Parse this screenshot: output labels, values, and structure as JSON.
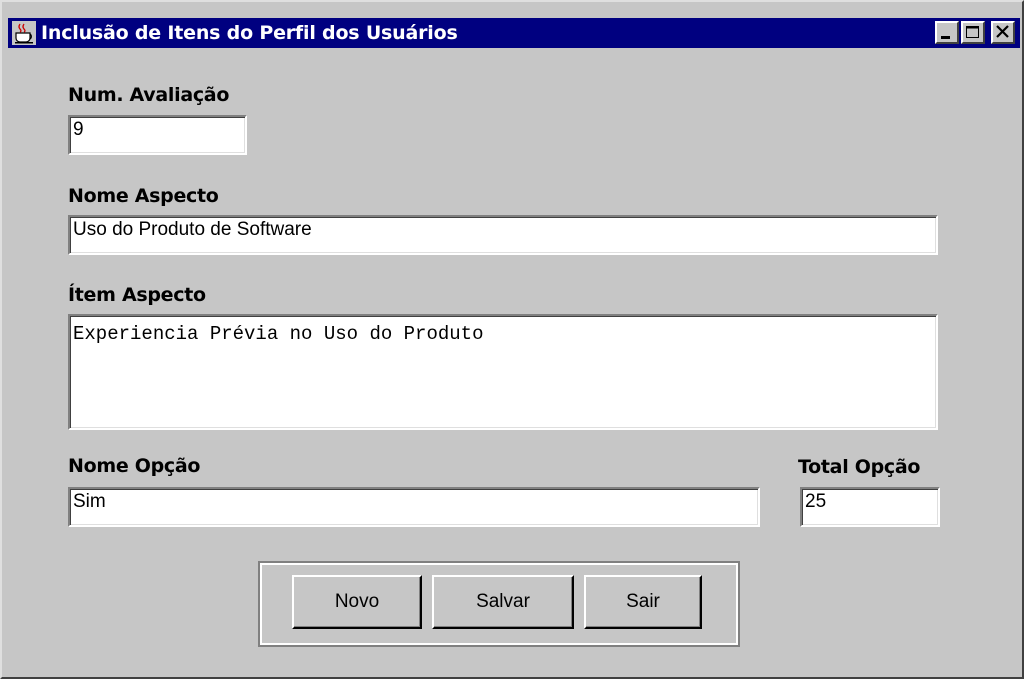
{
  "window": {
    "title": "Inclusão de Itens do Perfil dos Usuários",
    "title_icon": "java-coffee-cup-icon",
    "controls": [
      "minimize-icon",
      "maximize-icon",
      "close-icon"
    ]
  },
  "form": {
    "num_avaliacao": {
      "label": "Num. Avaliação",
      "value": "9"
    },
    "nome_aspecto": {
      "label": "Nome Aspecto",
      "value": "Uso do Produto de Software"
    },
    "item_aspecto": {
      "label": "Ítem Aspecto",
      "value": "Experiencia Prévia no Uso do Produto"
    },
    "nome_opcao": {
      "label": "Nome Opção",
      "value": "Sim"
    },
    "total_opcao": {
      "label": "Total Opção",
      "value": "25"
    }
  },
  "buttons": {
    "novo": "Novo",
    "salvar": "Salvar",
    "sair": "Sair"
  },
  "colors": {
    "titlebar": "#000080",
    "window_bg": "#c6c6c6"
  }
}
